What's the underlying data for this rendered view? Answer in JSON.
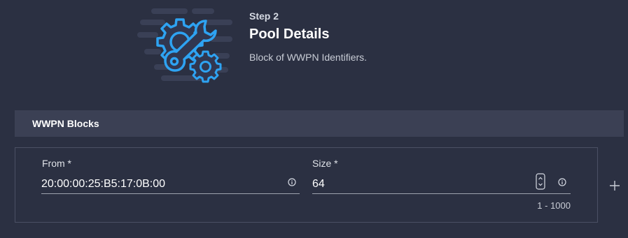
{
  "step": {
    "label": "Step 2",
    "title": "Pool Details",
    "description": "Block of WWPN Identifiers."
  },
  "section": {
    "title": "WWPN Blocks"
  },
  "block": {
    "from": {
      "label": "From *",
      "value": "20:00:00:25:B5:17:0B:00",
      "info_icon": "info-icon"
    },
    "size": {
      "label": "Size *",
      "value": "64",
      "hint": "1 - 1000",
      "stepper_icon": "stepper-icon",
      "info_icon": "info-icon"
    }
  },
  "actions": {
    "add_icon": "plus-icon"
  },
  "colors": {
    "background": "#2b3042",
    "section_header": "#3b4054",
    "accent": "#2ea3f2"
  }
}
